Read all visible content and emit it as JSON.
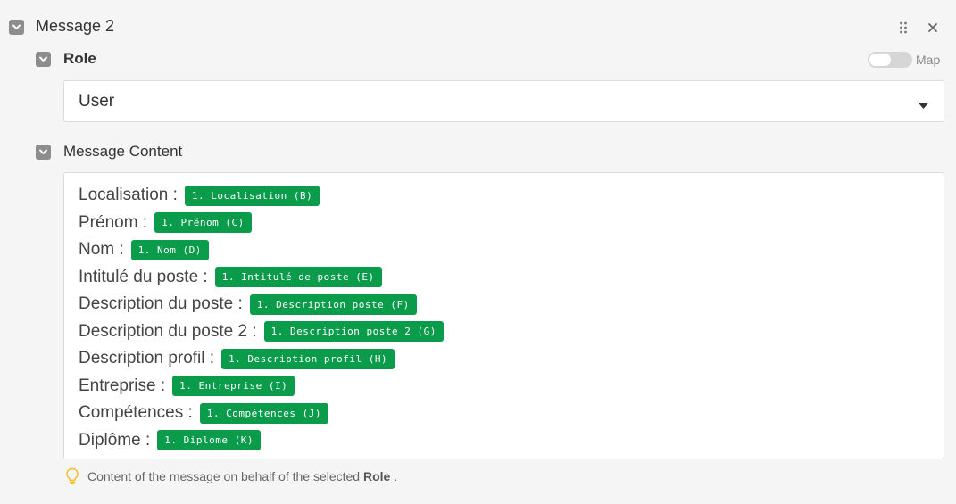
{
  "header": {
    "title": "Message 2"
  },
  "role": {
    "label": "Role",
    "map_label": "Map",
    "value": "User"
  },
  "message_content": {
    "label": "Message Content",
    "lines": [
      {
        "label": "Localisation :",
        "pill": "1. Localisation (B)"
      },
      {
        "label": "Prénom :",
        "pill": "1. Prénom (C)"
      },
      {
        "label": "Nom :",
        "pill": "1. Nom (D)"
      },
      {
        "label": "Intitulé du poste :",
        "pill": "1. Intitulé de poste (E)"
      },
      {
        "label": "Description du poste :",
        "pill": "1. Description poste (F)"
      },
      {
        "label": "Description du poste 2 :",
        "pill": "1. Description poste 2 (G)"
      },
      {
        "label": "Description profil :",
        "pill": "1. Description profil (H)"
      },
      {
        "label": "Entreprise :",
        "pill": "1. Entreprise (I)"
      },
      {
        "label": "Compétences :",
        "pill": "1. Compétences (J)"
      },
      {
        "label": "Diplôme :",
        "pill": "1. Diplome (K)"
      }
    ]
  },
  "hint": {
    "prefix": "Content of the message on behalf of the selected",
    "bold": "Role",
    "suffix": "."
  },
  "colors": {
    "pill_green": "#0a9b4b",
    "chevron_gray": "#8d8d8d"
  },
  "icons": [
    "chevron-down-icon",
    "drag-handle-icon",
    "close-icon",
    "caret-down-icon",
    "lightbulb-icon"
  ]
}
